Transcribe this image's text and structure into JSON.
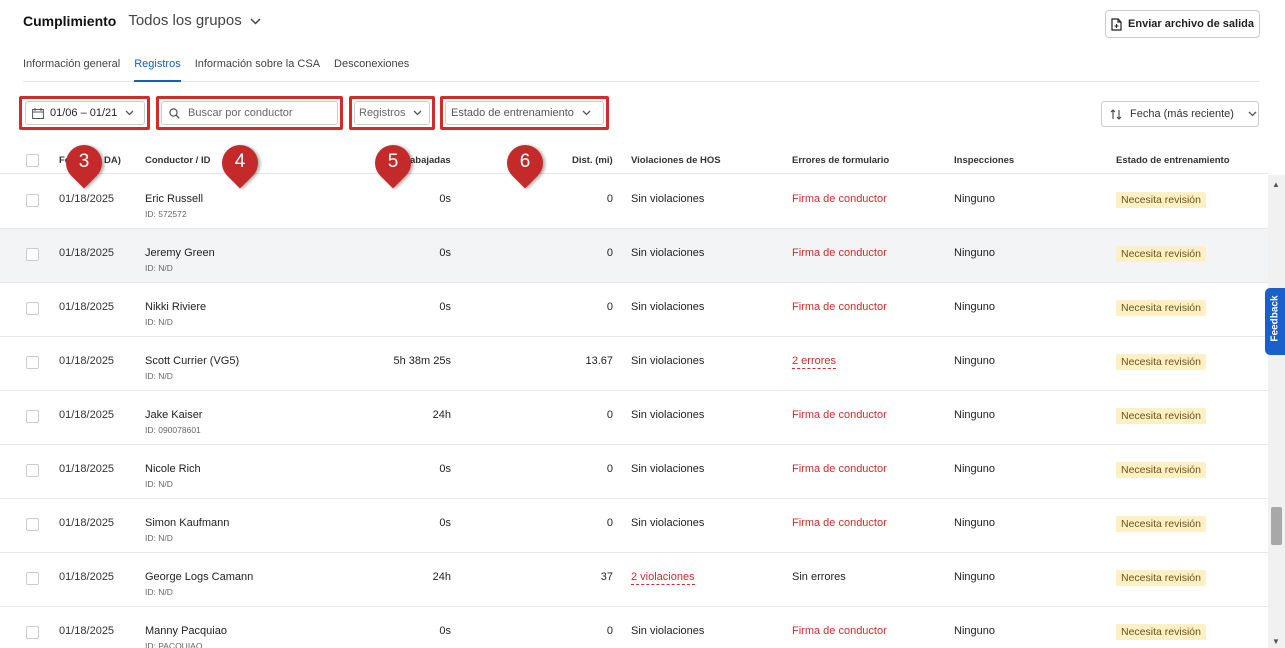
{
  "header": {
    "title": "Cumplimiento",
    "group_select": "Todos los grupos",
    "export_button": "Enviar archivo de salida"
  },
  "tabs": [
    "Información general",
    "Registros",
    "Información sobre la CSA",
    "Desconexiones"
  ],
  "active_tab": "Registros",
  "filters": {
    "date_range": "01/06 – 01/21",
    "search_placeholder": "Buscar por conductor",
    "logs_select": "Registros",
    "training_status_select": "Estado de entrenamiento",
    "sort_select": "Fecha (más reciente)"
  },
  "columns": {
    "date": "Fe",
    "date_tail": "DA)",
    "driver": "Conductor / ID",
    "hours": "abajadas",
    "distance": "Dist. (mi)",
    "hos": "Violaciones de HOS",
    "form_errors": "Errores de formulario",
    "inspections": "Inspecciones",
    "training_status": "Estado de entrenamiento"
  },
  "markers": [
    "3",
    "4",
    "5",
    "6"
  ],
  "rows": [
    {
      "date": "01/18/2025",
      "driver": "Eric Russell",
      "id": "ID: 572572",
      "hours": "0s",
      "dist": "0",
      "hos": "Sin violaciones",
      "form": "Firma de conductor",
      "insp": "Ninguno",
      "status": "Necesita revisión"
    },
    {
      "date": "01/18/2025",
      "driver": "Jeremy Green",
      "id": "ID: N/D",
      "hours": "0s",
      "dist": "0",
      "hos": "Sin violaciones",
      "form": "Firma de conductor",
      "insp": "Ninguno",
      "status": "Necesita revisión"
    },
    {
      "date": "01/18/2025",
      "driver": "Nikki Riviere",
      "id": "ID: N/D",
      "hours": "0s",
      "dist": "0",
      "hos": "Sin violaciones",
      "form": "Firma de conductor",
      "insp": "Ninguno",
      "status": "Necesita revisión"
    },
    {
      "date": "01/18/2025",
      "driver": "Scott Currier (VG5)",
      "id": "ID: N/D",
      "hours": "5h 38m 25s",
      "dist": "13.67",
      "hos": "Sin violaciones",
      "form": "2 errores",
      "insp": "Ninguno",
      "status": "Necesita revisión"
    },
    {
      "date": "01/18/2025",
      "driver": "Jake Kaiser",
      "id": "ID: 090078601",
      "hours": "24h",
      "dist": "0",
      "hos": "Sin violaciones",
      "form": "Firma de conductor",
      "insp": "Ninguno",
      "status": "Necesita revisión"
    },
    {
      "date": "01/18/2025",
      "driver": "Nicole Rich",
      "id": "ID: N/D",
      "hours": "0s",
      "dist": "0",
      "hos": "Sin violaciones",
      "form": "Firma de conductor",
      "insp": "Ninguno",
      "status": "Necesita revisión"
    },
    {
      "date": "01/18/2025",
      "driver": "Simon Kaufmann",
      "id": "ID: N/D",
      "hours": "0s",
      "dist": "0",
      "hos": "Sin violaciones",
      "form": "Firma de conductor",
      "insp": "Ninguno",
      "status": "Necesita revisión"
    },
    {
      "date": "01/18/2025",
      "driver": "George Logs Camann",
      "id": "ID: N/D",
      "hours": "24h",
      "dist": "37",
      "hos": "2 violaciones",
      "form": "Sin errores",
      "insp": "Ninguno",
      "status": "Necesita revisión"
    },
    {
      "date": "01/18/2025",
      "driver": "Manny Pacquiao",
      "id": "ID: PACQUIAO",
      "hours": "0s",
      "dist": "0",
      "hos": "Sin violaciones",
      "form": "Firma de conductor",
      "insp": "Ninguno",
      "status": "Necesita revisión"
    }
  ],
  "feedback": "Feedback",
  "colors": {
    "accent": "#0b64c0",
    "error": "#d12b2b",
    "badge_bg": "#fdf0c4",
    "marker": "#c42a2a",
    "feedback": "#1a5fcb"
  }
}
